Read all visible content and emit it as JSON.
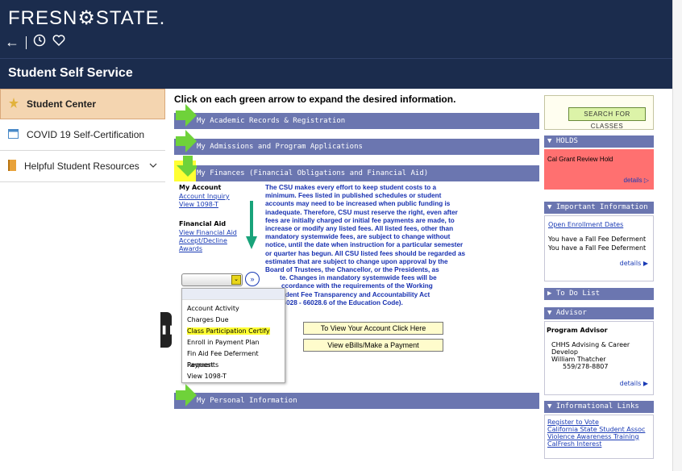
{
  "header": {
    "logo": "FRESN⚙STATE.",
    "title": "Student Self Service"
  },
  "sidebar": {
    "items": [
      {
        "label": "Student Center",
        "icon": "star-icon"
      },
      {
        "label": "COVID 19 Self-Certification",
        "icon": "document-icon"
      },
      {
        "label": "Helpful Student Resources",
        "icon": "book-icon"
      }
    ]
  },
  "main": {
    "intro": "Click on each green arrow to expand the desired information.",
    "sections": {
      "academic": "My Academic Records & Registration",
      "admissions": "My Admissions and Program Applications",
      "finances": "My Finances (Financial Obligations and Financial Aid)",
      "personal": "My Personal Information"
    },
    "account": {
      "heading": "My Account",
      "links": [
        "Account Inquiry",
        "View 1098-T"
      ]
    },
    "financial_aid": {
      "heading": "Financial Aid",
      "links": [
        "View Financial Aid",
        "Accept/Decline Awards"
      ]
    },
    "policy_lines": [
      "The CSU makes every effort to keep student costs to a",
      "minimum. Fees listed in published schedules or student",
      "accounts may need to be increased when public funding is",
      "inadequate. Therefore, CSU must reserve the right, even after",
      "fees are initially charged or initial fee payments are made, to",
      "increase or modify any listed fees. All listed fees, other than",
      "mandatory systemwide fees, are subject to change without",
      "notice, until the date when instruction for a particular semester",
      "or quarter has begun. All CSU listed fees should be regarded as",
      "estimates that are subject to change upon approval by the",
      "Board of Trustees, the Chancellor, or the Presidents, as",
      "te. Changes in mandatory systemwide fees will be",
      "ccordance with the requirements of the Working",
      "tudent Fee Transparency and Accountability Act",
      "66028 - 66028.6 of the Education Code)."
    ],
    "dropdown": {
      "options": [
        "Account Activity",
        "Charges Due",
        "Class Participation Certify",
        "Enroll in Payment Plan",
        "Fin Aid Fee Deferment Request",
        "Payments",
        "View 1098-T"
      ],
      "highlighted": "Class Participation Certify"
    },
    "buttons": {
      "view_account": "To View Your Account Click Here",
      "ebills": "View eBills/Make a Payment"
    }
  },
  "right": {
    "search_label": "Search For Classes",
    "holds": {
      "header": "HOLDS",
      "item": "Cal Grant Review Hold",
      "details": "details"
    },
    "important": {
      "header": "Important Information",
      "link": "Open Enrollment Dates",
      "line1": "You have a Fall Fee Deferment",
      "line2": "You have a Fall Fee Deferment",
      "details": "details"
    },
    "todo": {
      "header": "To Do List"
    },
    "advisor": {
      "header": "Advisor",
      "title": "Program Advisor",
      "line1": "CHHS Advising & Career",
      "line2": "Develop",
      "name": "William Thatcher",
      "phone": "559/278-8807",
      "details": "details"
    },
    "links": {
      "header": "Informational Links",
      "items": [
        "Register to Vote",
        "California State Student Assoc",
        "Violence Awareness Training",
        "CalFresh Interest"
      ]
    }
  },
  "colors": {
    "header_bg": "#1b2c4d",
    "section_bar": "#6b76b0",
    "highlight": "#ffff33",
    "holds_bg": "#ff7070",
    "arrow_green": "#19a37a"
  }
}
